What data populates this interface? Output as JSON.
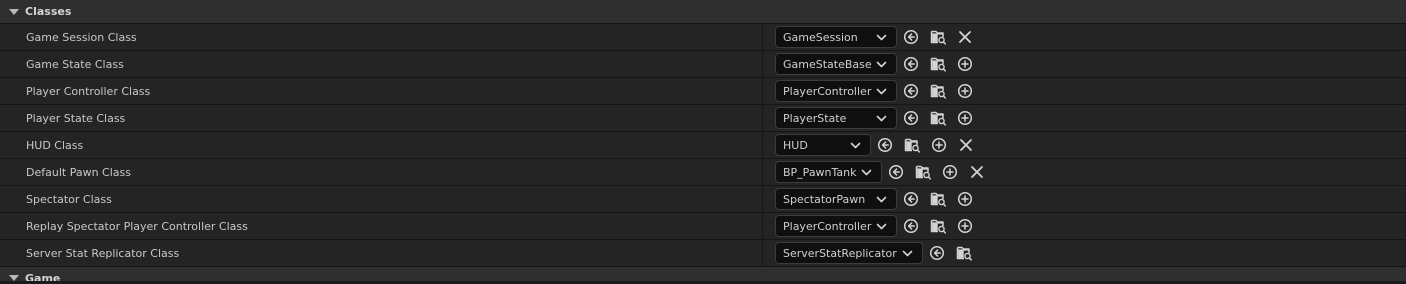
{
  "section": {
    "title": "Classes",
    "expanded": true
  },
  "next_section": {
    "title": "Game",
    "expanded": true
  },
  "icons": {
    "use": "arrow-left-circle-icon",
    "browse": "folder-search-icon",
    "create": "plus-circle-icon",
    "clear": "close-icon",
    "dropdown": "chevron-down-icon"
  },
  "colors": {
    "background": "#1a1a1a",
    "row": "#242424",
    "header": "#2f2f2f",
    "combo": "#0f0f0f",
    "icon": "#d4d4d4"
  },
  "rows": [
    {
      "key": "game-session-class",
      "label": "Game Session Class",
      "value": "GameSession",
      "actions": [
        "use",
        "browse",
        "clear"
      ]
    },
    {
      "key": "game-state-class",
      "label": "Game State Class",
      "value": "GameStateBase",
      "actions": [
        "use",
        "browse",
        "create"
      ]
    },
    {
      "key": "player-controller-class",
      "label": "Player Controller Class",
      "value": "PlayerController",
      "actions": [
        "use",
        "browse",
        "create"
      ]
    },
    {
      "key": "player-state-class",
      "label": "Player State Class",
      "value": "PlayerState",
      "actions": [
        "use",
        "browse",
        "create"
      ]
    },
    {
      "key": "hud-class",
      "label": "HUD Class",
      "value": "HUD",
      "actions": [
        "use",
        "browse",
        "create",
        "clear"
      ]
    },
    {
      "key": "default-pawn-class",
      "label": "Default Pawn Class",
      "value": "BP_PawnTank",
      "actions": [
        "use",
        "browse",
        "create",
        "clear"
      ]
    },
    {
      "key": "spectator-class",
      "label": "Spectator Class",
      "value": "SpectatorPawn",
      "actions": [
        "use",
        "browse",
        "create"
      ]
    },
    {
      "key": "replay-spectator-player-controller-class",
      "label": "Replay Spectator Player Controller Class",
      "value": "PlayerController",
      "actions": [
        "use",
        "browse",
        "create"
      ]
    },
    {
      "key": "server-stat-replicator-class",
      "label": "Server Stat Replicator Class",
      "value": "ServerStatReplicator",
      "actions": [
        "use",
        "browse"
      ]
    }
  ]
}
